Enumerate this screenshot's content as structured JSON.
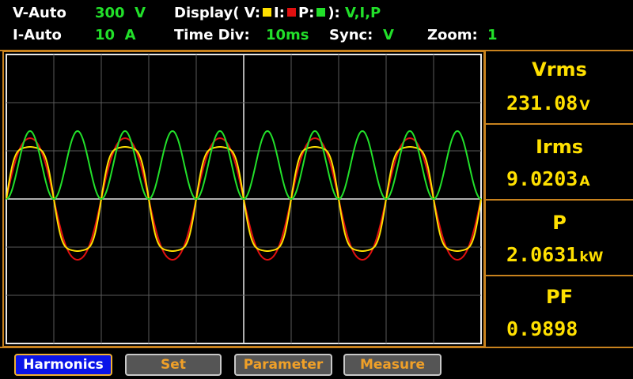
{
  "header": {
    "v_range_label": "V-Auto",
    "v_range_value": "300",
    "v_range_unit": "V",
    "i_range_label": "I-Auto",
    "i_range_value": "10",
    "i_range_unit": "A",
    "display_prefix": "Display( V:",
    "display_i_label": "I:",
    "display_p_label": "P:",
    "display_suffix": "):",
    "display_value": "V,I,P",
    "time_div_label": "Time  Div:",
    "time_div_value": "10ms",
    "sync_label": "Sync:",
    "sync_value": "V",
    "zoom_label": "Zoom:",
    "zoom_value": "1"
  },
  "colors": {
    "voltage": "#ffe000",
    "current": "#e01010",
    "power": "#22e02a",
    "accent": "#c8821e",
    "grid": "#5a5a5a"
  },
  "measurements": [
    {
      "label": "Vrms",
      "value": "231.08",
      "unit": "V"
    },
    {
      "label": "Irms",
      "value": "9.0203",
      "unit": "A"
    },
    {
      "label": "P",
      "value": "2.0631",
      "unit": "kW"
    },
    {
      "label": "PF",
      "value": "0.9898",
      "unit": ""
    }
  ],
  "buttons": [
    {
      "label": "Harmonics",
      "active": true
    },
    {
      "label": "Set",
      "active": false
    },
    {
      "label": "Parameter",
      "active": false
    },
    {
      "label": "Measure",
      "active": false
    }
  ],
  "scope": {
    "time_divisions": 10,
    "voltage_divisions": 6,
    "time_per_division_ms": 10,
    "signal_frequency_hz": 50
  }
}
